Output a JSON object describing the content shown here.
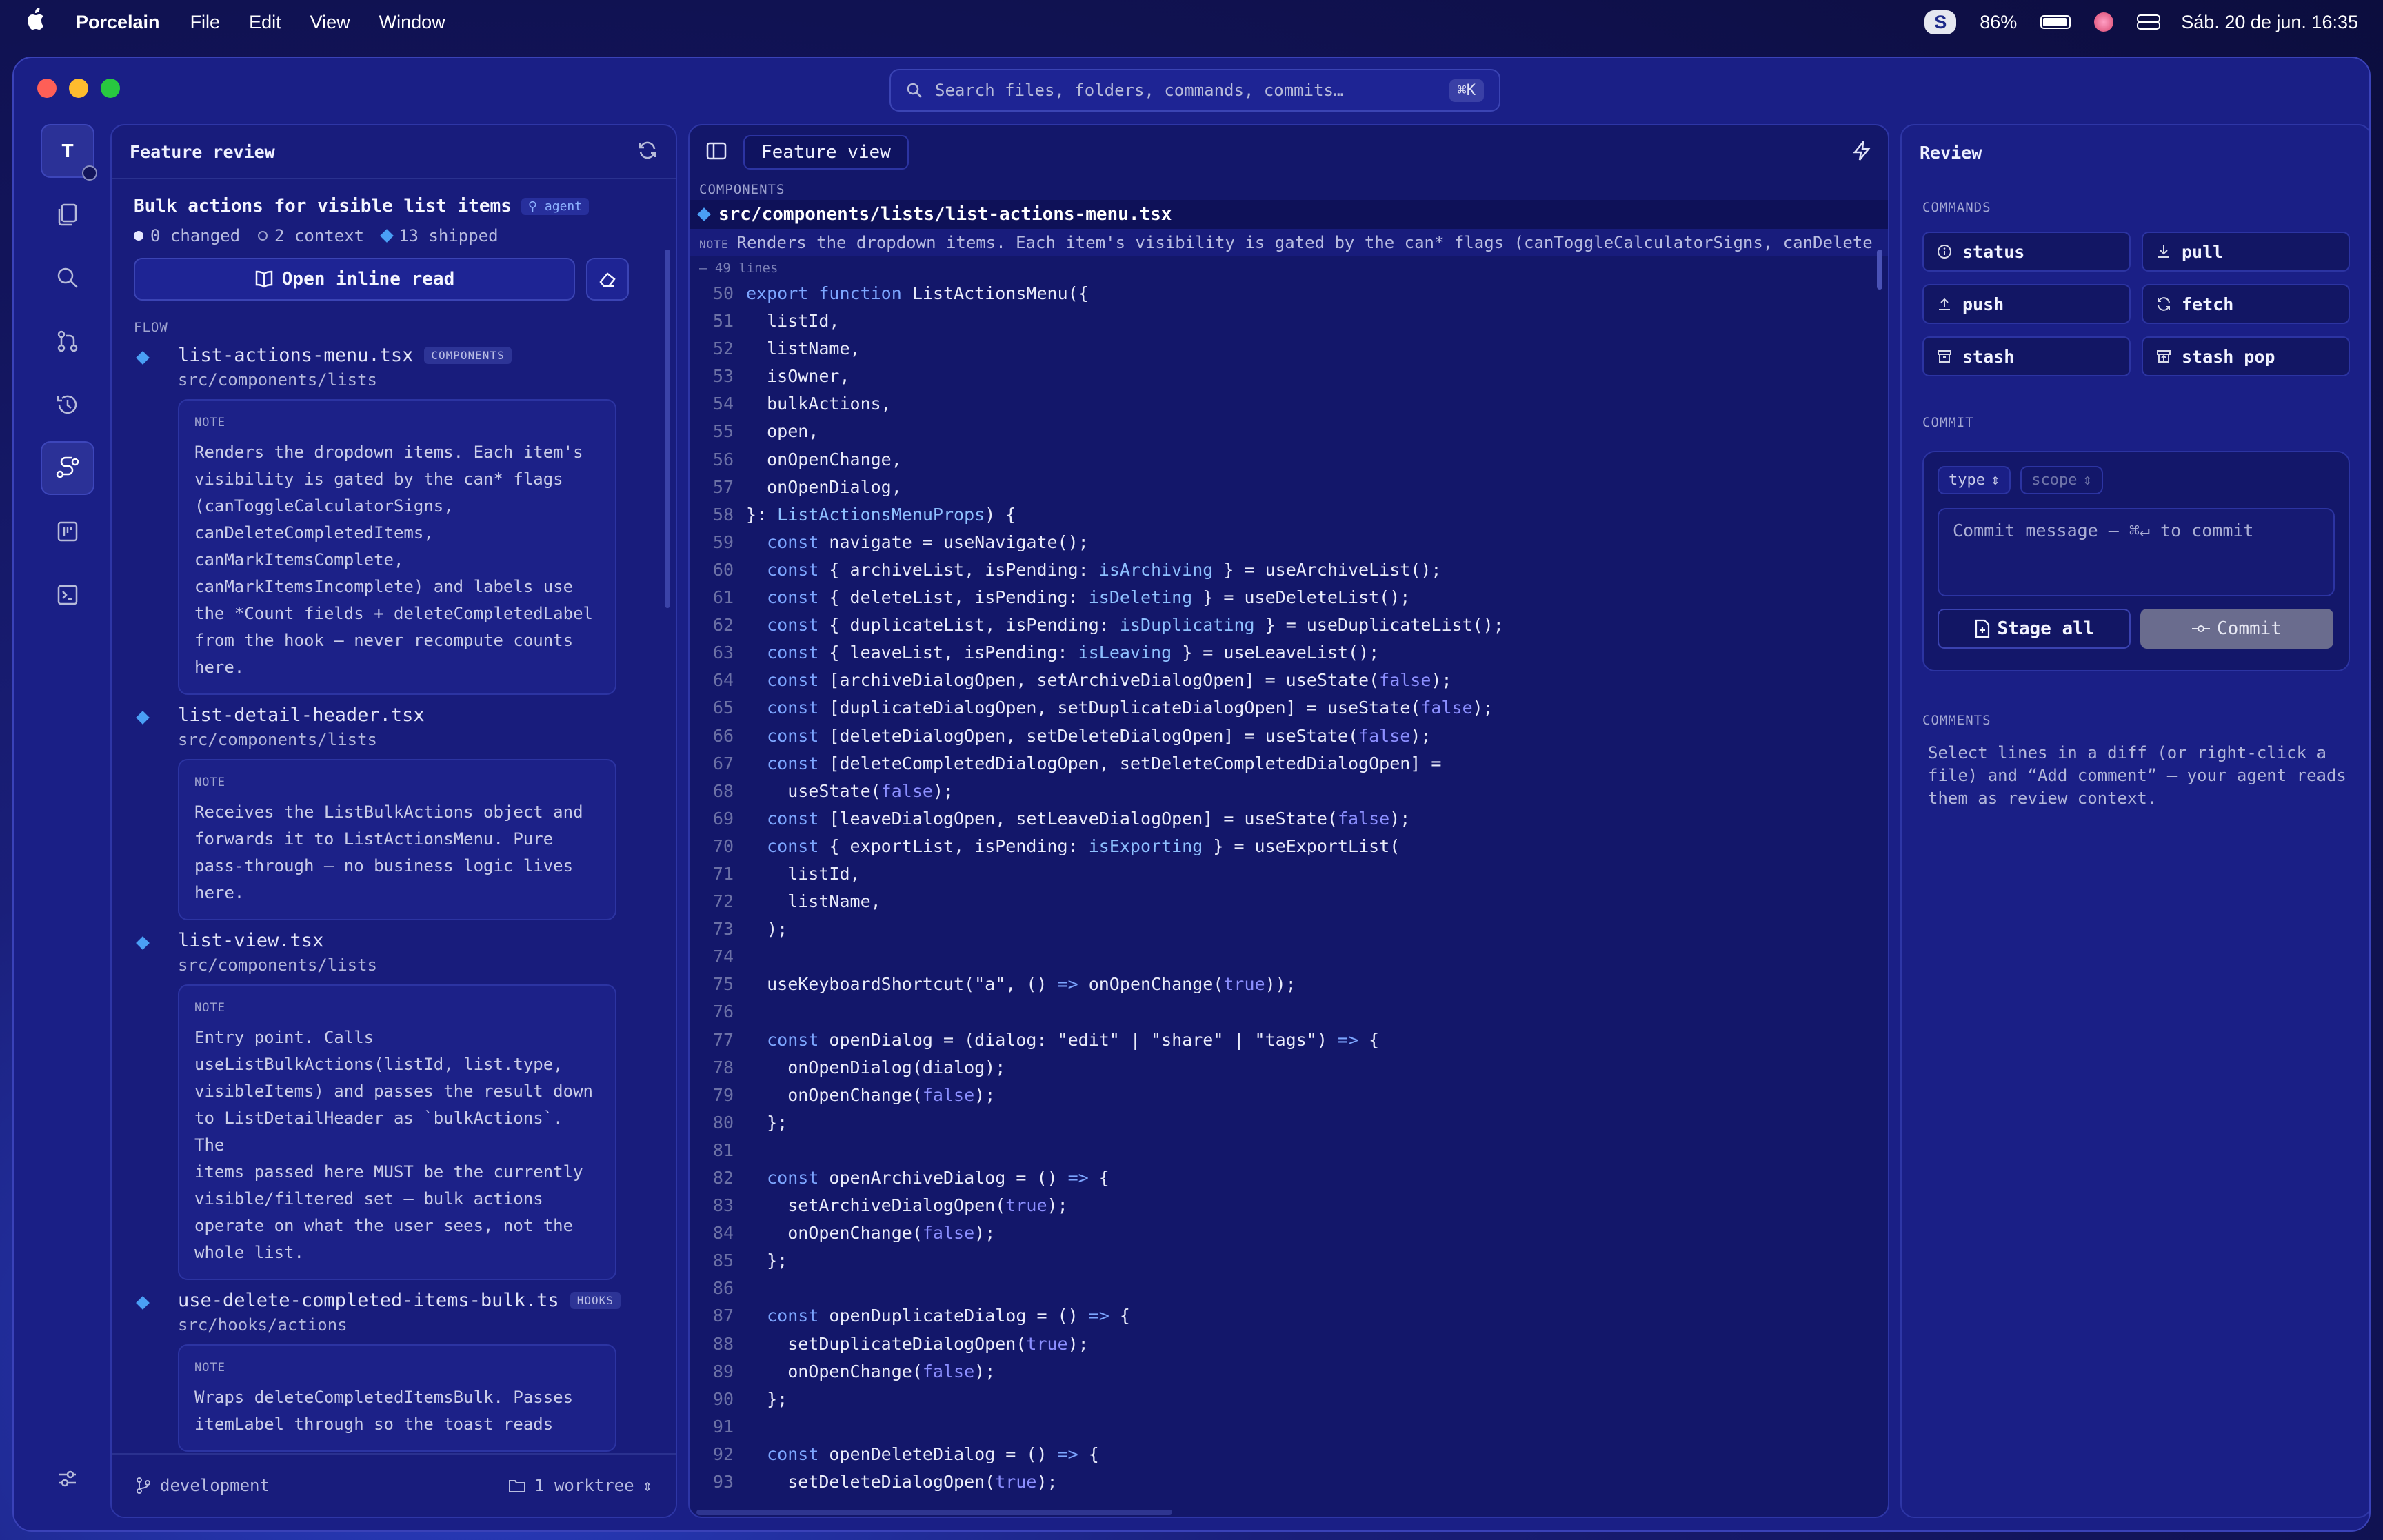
{
  "menubar": {
    "app_name": "Porcelain",
    "menus": [
      "File",
      "Edit",
      "View",
      "Window"
    ],
    "s_badge": "S",
    "battery_percent": "86%",
    "datetime": "Sáb. 20 de jun.  16:35"
  },
  "search": {
    "placeholder": "Search files, folders, commands, commits…",
    "shortcut": "⌘K"
  },
  "left": {
    "header_title": "Feature review",
    "feature_title": "Bulk actions for visible list items",
    "agent_badge": "agent",
    "stats": {
      "changed": "0 changed",
      "context": "2 context",
      "shipped": "13 shipped"
    },
    "open_button": "Open inline read",
    "flow_label": "FLOW",
    "note_label": "NOTE",
    "flow": [
      {
        "file": "list-actions-menu.tsx",
        "tag": "COMPONENTS",
        "path": "src/components/lists",
        "note": "Renders the dropdown items. Each item's\nvisibility is gated by the can* flags\n(canToggleCalculatorSigns,\ncanDeleteCompletedItems,\ncanMarkItemsComplete,\ncanMarkItemsIncomplete) and labels use\nthe *Count fields + deleteCompletedLabel\nfrom the hook — never recompute counts\nhere."
      },
      {
        "file": "list-detail-header.tsx",
        "tag": "",
        "path": "src/components/lists",
        "note": "Receives the ListBulkActions object and\nforwards it to ListActionsMenu. Pure\npass-through — no business logic lives\nhere."
      },
      {
        "file": "list-view.tsx",
        "tag": "",
        "path": "src/components/lists",
        "note": "Entry point. Calls\nuseListBulkActions(listId, list.type,\nvisibleItems) and passes the result down\nto ListDetailHeader as `bulkActions`. The\nitems passed here MUST be the currently\nvisible/filtered set — bulk actions\noperate on what the user sees, not the\nwhole list."
      },
      {
        "file": "use-delete-completed-items-bulk.ts",
        "tag": "HOOKS",
        "path": "src/hooks/actions",
        "note": "Wraps deleteCompletedItemsBulk. Passes\nitemLabel through so the toast reads"
      }
    ],
    "footer_branch": "development",
    "footer_worktree": "1 worktree"
  },
  "center": {
    "view_label": "Feature view",
    "components_label": "COMPONENTS",
    "file_path": "src/components/lists/list-actions-menu.tsx",
    "note_label": "NOTE",
    "note_text": "Renders the dropdown items. Each item's visibility is gated by the can* flags (canToggleCalculatorSigns, canDelete",
    "lines_info": "– 49 lines",
    "code": [
      {
        "n": "50",
        "t": "export function ListActionsMenu({"
      },
      {
        "n": "51",
        "t": "  listId,"
      },
      {
        "n": "52",
        "t": "  listName,"
      },
      {
        "n": "53",
        "t": "  isOwner,"
      },
      {
        "n": "54",
        "t": "  bulkActions,"
      },
      {
        "n": "55",
        "t": "  open,"
      },
      {
        "n": "56",
        "t": "  onOpenChange,"
      },
      {
        "n": "57",
        "t": "  onOpenDialog,"
      },
      {
        "n": "58",
        "t": "}: ListActionsMenuProps) {"
      },
      {
        "n": "59",
        "t": "  const navigate = useNavigate();"
      },
      {
        "n": "60",
        "t": "  const { archiveList, isPending: isArchiving } = useArchiveList();"
      },
      {
        "n": "61",
        "t": "  const { deleteList, isPending: isDeleting } = useDeleteList();"
      },
      {
        "n": "62",
        "t": "  const { duplicateList, isPending: isDuplicating } = useDuplicateList();"
      },
      {
        "n": "63",
        "t": "  const { leaveList, isPending: isLeaving } = useLeaveList();"
      },
      {
        "n": "64",
        "t": "  const [archiveDialogOpen, setArchiveDialogOpen] = useState(false);"
      },
      {
        "n": "65",
        "t": "  const [duplicateDialogOpen, setDuplicateDialogOpen] = useState(false);"
      },
      {
        "n": "66",
        "t": "  const [deleteDialogOpen, setDeleteDialogOpen] = useState(false);"
      },
      {
        "n": "67",
        "t": "  const [deleteCompletedDialogOpen, setDeleteCompletedDialogOpen] ="
      },
      {
        "n": "68",
        "t": "    useState(false);"
      },
      {
        "n": "69",
        "t": "  const [leaveDialogOpen, setLeaveDialogOpen] = useState(false);"
      },
      {
        "n": "70",
        "t": "  const { exportList, isPending: isExporting } = useExportList("
      },
      {
        "n": "71",
        "t": "    listId,"
      },
      {
        "n": "72",
        "t": "    listName,"
      },
      {
        "n": "73",
        "t": "  );"
      },
      {
        "n": "74",
        "t": ""
      },
      {
        "n": "75",
        "t": "  useKeyboardShortcut(\"a\", () => onOpenChange(true));"
      },
      {
        "n": "76",
        "t": ""
      },
      {
        "n": "77",
        "t": "  const openDialog = (dialog: \"edit\" | \"share\" | \"tags\") => {"
      },
      {
        "n": "78",
        "t": "    onOpenDialog(dialog);"
      },
      {
        "n": "79",
        "t": "    onOpenChange(false);"
      },
      {
        "n": "80",
        "t": "  };"
      },
      {
        "n": "81",
        "t": ""
      },
      {
        "n": "82",
        "t": "  const openArchiveDialog = () => {"
      },
      {
        "n": "83",
        "t": "    setArchiveDialogOpen(true);"
      },
      {
        "n": "84",
        "t": "    onOpenChange(false);"
      },
      {
        "n": "85",
        "t": "  };"
      },
      {
        "n": "86",
        "t": ""
      },
      {
        "n": "87",
        "t": "  const openDuplicateDialog = () => {"
      },
      {
        "n": "88",
        "t": "    setDuplicateDialogOpen(true);"
      },
      {
        "n": "89",
        "t": "    onOpenChange(false);"
      },
      {
        "n": "90",
        "t": "  };"
      },
      {
        "n": "91",
        "t": ""
      },
      {
        "n": "92",
        "t": "  const openDeleteDialog = () => {"
      },
      {
        "n": "93",
        "t": "    setDeleteDialogOpen(true);"
      }
    ]
  },
  "right": {
    "header_title": "Review",
    "commands_label": "COMMANDS",
    "commands": [
      {
        "label": "status",
        "icon": "info-icon"
      },
      {
        "label": "pull",
        "icon": "download-icon"
      },
      {
        "label": "push",
        "icon": "upload-icon"
      },
      {
        "label": "fetch",
        "icon": "refresh-icon"
      },
      {
        "label": "stash",
        "icon": "archive-icon"
      },
      {
        "label": "stash pop",
        "icon": "archive-out-icon"
      }
    ],
    "commit_label": "COMMIT",
    "type_select": "type",
    "scope_select": "scope",
    "commit_placeholder": "Commit message — ⌘↵ to commit",
    "stage_all": "Stage all",
    "commit_button": "Commit",
    "comments_label": "COMMENTS",
    "comments_text": "Select lines in a diff (or right-click a file) and “Add comment” — your agent reads them as review context."
  },
  "rail": {
    "avatar_letter": "T",
    "items": [
      "files-icon",
      "search-icon",
      "git-branch-icon",
      "history-icon",
      "flow-icon",
      "board-icon",
      "terminal-icon"
    ],
    "active": "flow-icon"
  },
  "colors": {
    "accent_blue": "#4a9ff5",
    "window_bg": "#1a1f86",
    "code_bg": "#13176a"
  }
}
